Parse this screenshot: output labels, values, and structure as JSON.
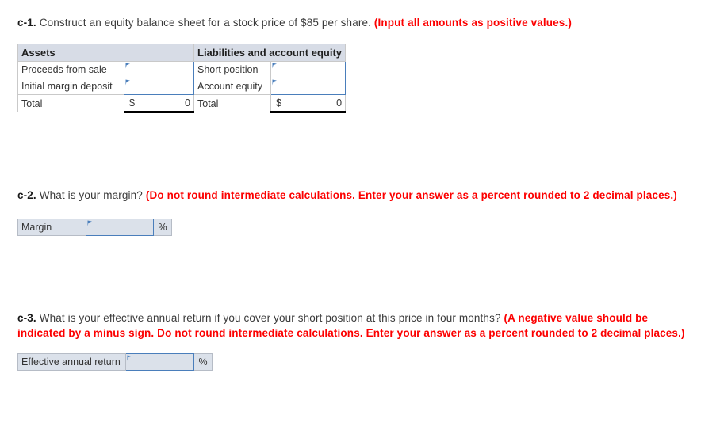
{
  "questions": {
    "c1": {
      "tag": "c-1.",
      "text": " Construct an equity balance sheet for a stock price of $85 per share. ",
      "hint": "(Input all amounts as positive values.)"
    },
    "c2": {
      "tag": "c-2.",
      "text": " What is your margin? ",
      "hint": "(Do not round intermediate calculations. Enter your answer as a percent rounded to 2 decimal places.)"
    },
    "c3": {
      "tag": "c-3.",
      "text": " What is your effective annual return if you cover your short position at this price in four months? ",
      "hint": "(A negative value should be indicated by a minus sign. Do not round intermediate calculations. Enter your answer as a percent rounded to 2 decimal places.)"
    }
  },
  "balance_sheet": {
    "headers": {
      "assets": "Assets",
      "spacer": "",
      "liabilities": "Liabilities and account equity"
    },
    "rows": [
      {
        "asset_label": "Proceeds from sale",
        "asset_value": "",
        "liability_label": "Short position",
        "liability_value": ""
      },
      {
        "asset_label": "Initial margin deposit",
        "asset_value": "",
        "liability_label": "Account equity",
        "liability_value": ""
      }
    ],
    "total_row": {
      "asset_label": "Total",
      "asset_currency": "$",
      "asset_total": "0",
      "liability_label": "Total",
      "liability_currency": "$",
      "liability_total": "0"
    }
  },
  "margin_answer": {
    "label": "Margin",
    "value": "",
    "unit": "%"
  },
  "ear_answer": {
    "label": "Effective annual return",
    "value": "",
    "unit": "%"
  },
  "colors": {
    "hint_red": "#fc0000",
    "header_fill": "#d7dce6",
    "input_border": "#4a7ebb",
    "answer_fill": "#dbe1ea",
    "flag_blue": "#4a7ebb"
  }
}
